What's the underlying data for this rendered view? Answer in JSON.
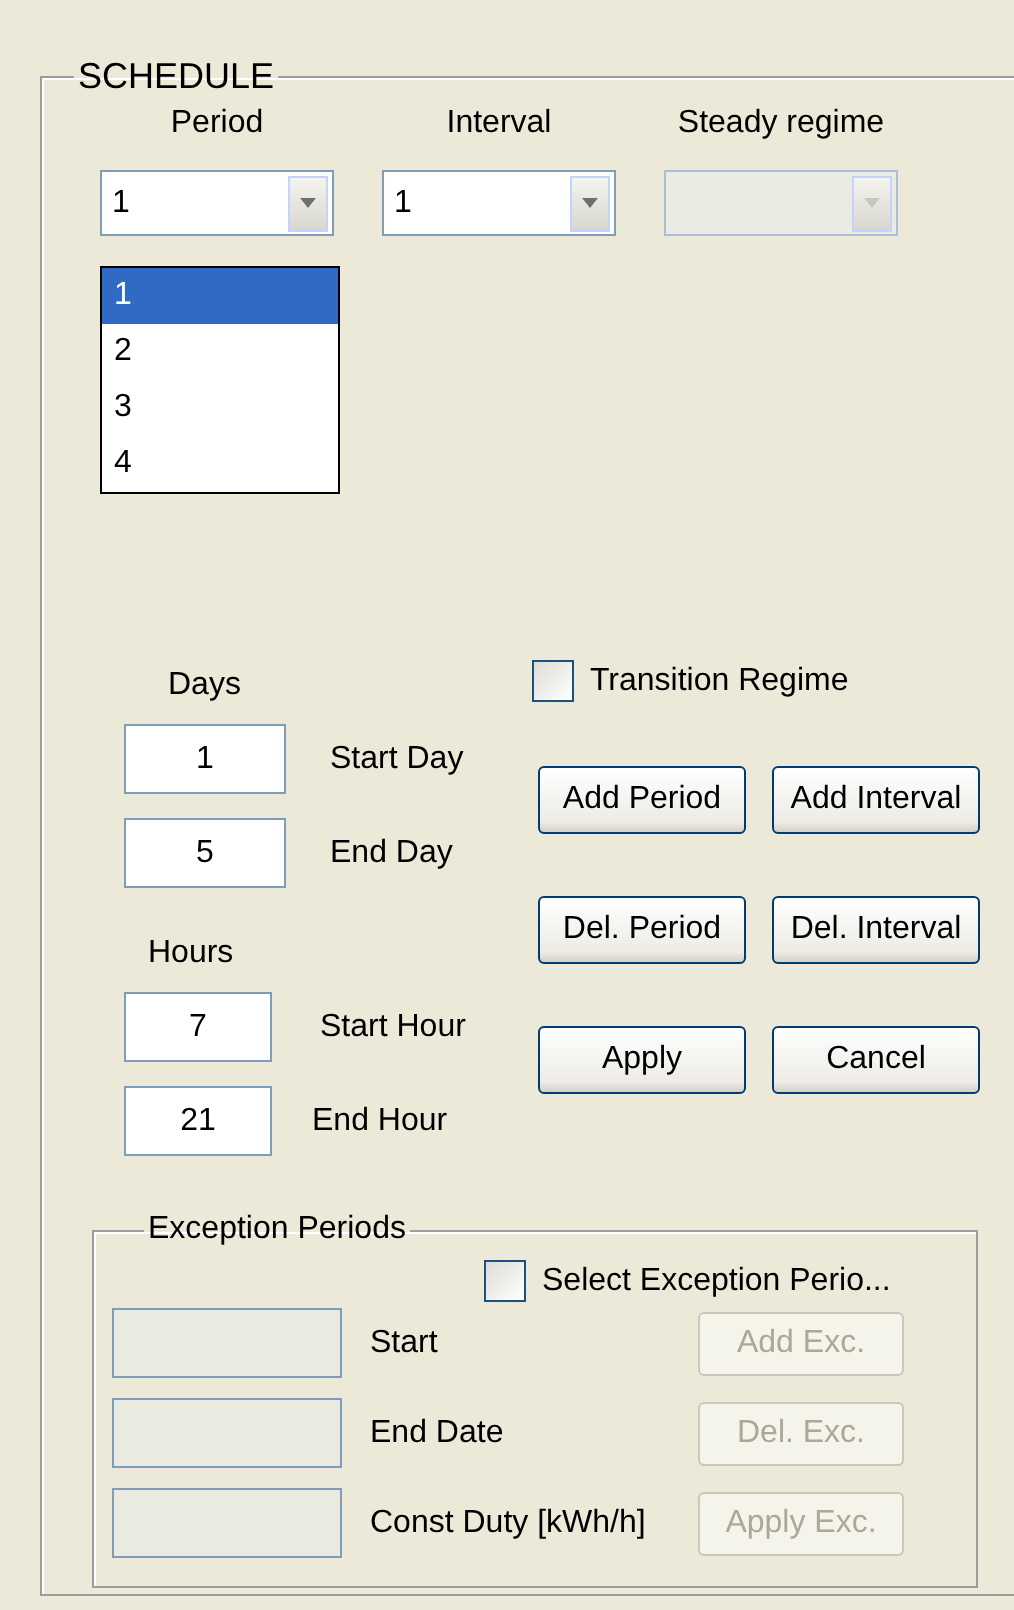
{
  "group": {
    "title": "SCHEDULE"
  },
  "selectors": [
    {
      "label": "Period",
      "value": "1",
      "disabled": false,
      "options": [
        {
          "label": "1",
          "selected": true
        },
        {
          "label": "2",
          "selected": false
        },
        {
          "label": "3",
          "selected": false
        },
        {
          "label": "4",
          "selected": false
        }
      ]
    },
    {
      "label": "Interval",
      "value": "1",
      "disabled": false
    },
    {
      "label": "Steady regime",
      "disabled": true
    }
  ],
  "days": {
    "title": "Days",
    "fields": [
      {
        "value": "1",
        "label": "Start Day"
      },
      {
        "value": "5",
        "label": "End Day"
      }
    ]
  },
  "hours": {
    "title": "Hours",
    "fields": [
      {
        "value": "7",
        "label": "Start Hour"
      },
      {
        "value": "21",
        "label": "End Hour"
      }
    ]
  },
  "transition": {
    "label": "Transition Regime",
    "checked": false
  },
  "buttons": [
    [
      {
        "label": "Add Period"
      },
      {
        "label": "Add Interval"
      }
    ],
    [
      {
        "label": "Del. Period"
      },
      {
        "label": "Del. Interval"
      }
    ],
    [
      {
        "label": "Apply"
      },
      {
        "label": "Cancel"
      }
    ]
  ],
  "exception": {
    "title": "Exception Periods",
    "checkbox": {
      "label": "Select Exception Perio...",
      "checked": false
    },
    "rows": [
      {
        "label": "Start",
        "button": "Add Exc.",
        "disabled": true
      },
      {
        "label": "End Date",
        "button": "Del. Exc.",
        "disabled": true
      },
      {
        "label": "Const Duty [kWh/h]",
        "button": "Apply Exc.",
        "disabled": true
      }
    ]
  }
}
